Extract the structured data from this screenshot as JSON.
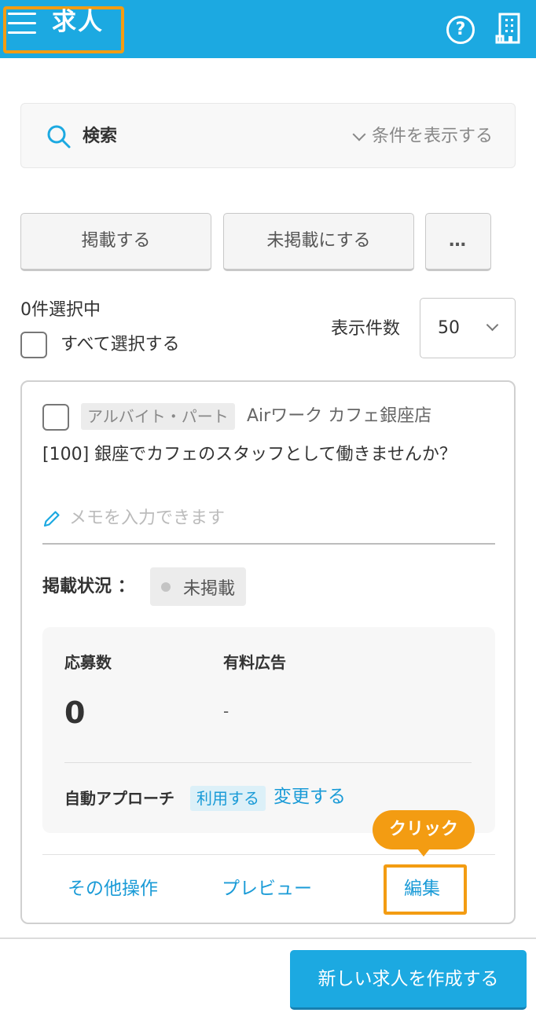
{
  "header": {
    "title": "求人",
    "menu_icon": "hamburger-menu-icon",
    "help_icon": "question-circle-icon",
    "help_glyph": "?",
    "store_icon": "building-icon",
    "bg_color": "#1ca9e1",
    "highlight_color": "#f39c12"
  },
  "search": {
    "label": "検索",
    "toggle_label": "条件を表示する"
  },
  "bulk_actions": {
    "publish_label": "掲載する",
    "unpublish_label": "未掲載にする",
    "more_label": "…"
  },
  "selection": {
    "count_text": "0件選択中",
    "select_all_label": "すべて選択する",
    "select_all_checked": false
  },
  "pagination": {
    "per_page_label": "表示件数",
    "per_page_value": "50"
  },
  "job": {
    "checked": false,
    "employment_type": "アルバイト・パート",
    "store_name": "Airワーク カフェ銀座店",
    "title": "[100] 銀座でカフェのスタッフとして働きませんか？",
    "memo_placeholder": "メモを入力できます",
    "status_label": "掲載状況 ：",
    "status_value": "未掲載",
    "applicants_label": "応募数",
    "applicants_value": "0",
    "paid_ads_label": "有料広告",
    "paid_ads_value": "-",
    "auto_approach_label": "自動アプローチ",
    "auto_approach_status": "利用する",
    "auto_approach_change": "変更する",
    "other_actions_label": "その他操作",
    "preview_label": "プレビュー",
    "edit_label": "編集",
    "click_tooltip": "クリック"
  },
  "footer": {
    "create_label": "新しい求人を作成する"
  }
}
